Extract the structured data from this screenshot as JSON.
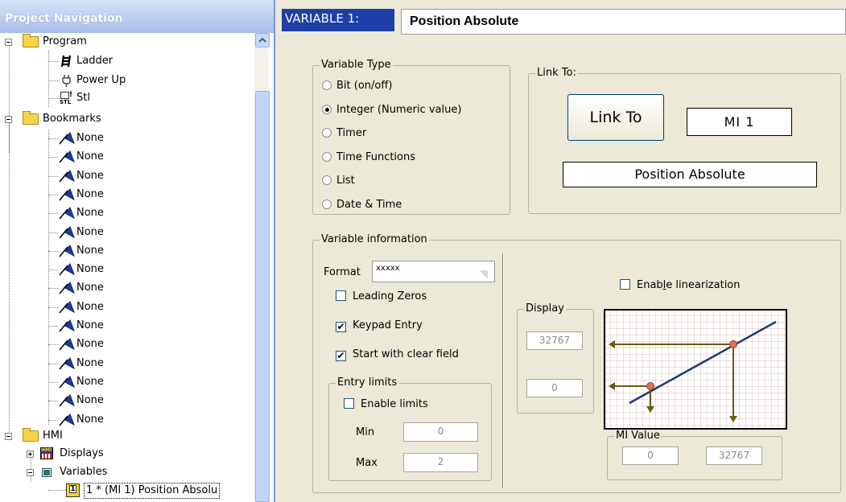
{
  "nav": {
    "title": "Project Navigation",
    "tree": {
      "program": "Program",
      "ladder": "Ladder",
      "power_up": "Power Up",
      "stl": "Stl",
      "stl_icon_text": "STL",
      "bookmarks": "Bookmarks",
      "bookmark_items": [
        "None",
        "None",
        "None",
        "None",
        "None",
        "None",
        "None",
        "None",
        "None",
        "None",
        "None",
        "None",
        "None",
        "None",
        "None",
        "None"
      ],
      "hmi": "HMI",
      "hmi_icon_text": "HMI",
      "displays": "Displays",
      "variables": "Variables",
      "selected_item": "1 * (MI 1) Position Absolu",
      "selected_icon_text": "1"
    }
  },
  "header": {
    "variable_label": "VARIABLE 1:",
    "variable_name": "Position Absolute"
  },
  "variable_type": {
    "title": "Variable Type",
    "options": [
      {
        "label": "Bit (on/off)",
        "selected": false
      },
      {
        "label": "Integer (Numeric value)",
        "selected": true
      },
      {
        "label": "Timer",
        "selected": false
      },
      {
        "label": "Time Functions",
        "selected": false
      },
      {
        "label": "List",
        "selected": false
      },
      {
        "label": "Date & Time",
        "selected": false
      }
    ]
  },
  "link_to": {
    "title": "Link To:",
    "button_label": "Link To",
    "operand": "MI  1",
    "description": "Position Absolute"
  },
  "variable_info": {
    "title": "Variable information",
    "format_label": "Format",
    "format_value": "xxxxx",
    "leading_zeros": {
      "label": "Leading Zeros",
      "checked": false
    },
    "keypad_entry": {
      "label": "Keypad Entry",
      "checked": true
    },
    "clear_field": {
      "label": "Start with clear field",
      "checked": true
    },
    "entry_limits": {
      "title": "Entry limits",
      "enable": {
        "label": "Enable limits",
        "checked": false
      },
      "min_label": "Min",
      "min_value": "0",
      "max_label": "Max",
      "max_value": "2"
    },
    "linearization": {
      "label": "Enable linearization",
      "underline_char": "l",
      "checked": false
    },
    "display": {
      "title": "Display",
      "high": "32767",
      "low": "0"
    },
    "mi_value": {
      "title": "MI Value",
      "low": "0",
      "high": "32767"
    }
  },
  "colors": {
    "header_bg": "#1e3fa6",
    "nav_title_bg": "#a7bde8",
    "chart_line": "#1d3a6e",
    "chart_arrow": "#6b5a10",
    "chart_point": "#e07050"
  }
}
